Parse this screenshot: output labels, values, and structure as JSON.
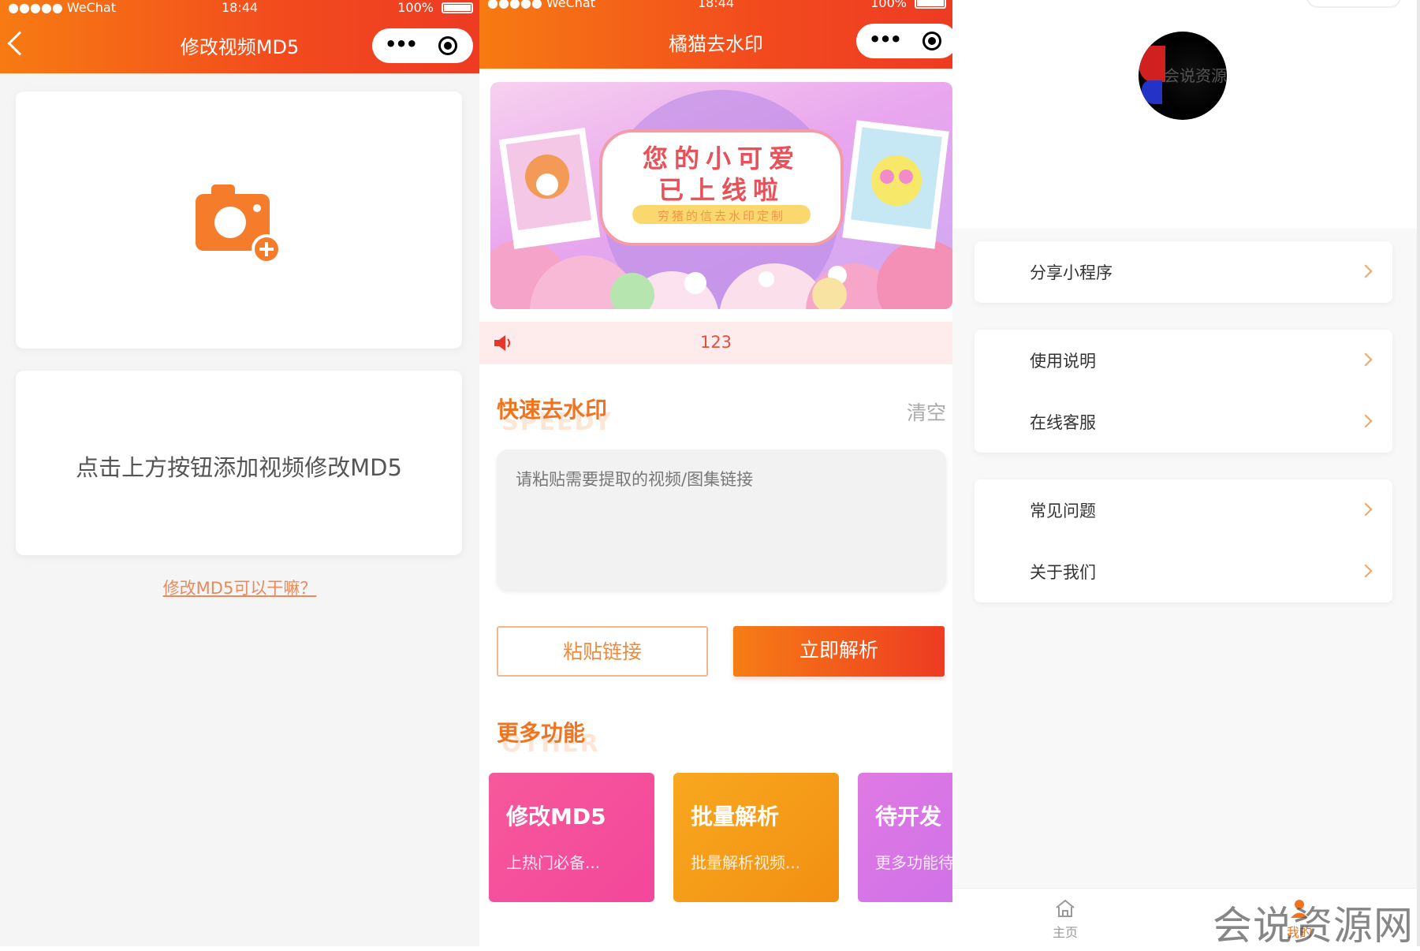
{
  "status": {
    "carrier": "●●●●● WeChat",
    "time": "18:44",
    "battery": "100%"
  },
  "panel1": {
    "title": "修改视频MD5",
    "hint": "点击上方按钮添加视频修改MD5",
    "link": "修改MD5可以干嘛？"
  },
  "panel2": {
    "title": "橘猫去水印",
    "banner": {
      "line1": "您的小可爱",
      "line2": "已上线啦",
      "tagline": "穷猪的信去水印定制"
    },
    "notice": "123",
    "section1": {
      "title": "快速去水印",
      "sub": "SPEEDY",
      "clear": "清空"
    },
    "input_placeholder": "请粘贴需要提取的视频/图集链接",
    "paste_btn": "粘贴链接",
    "parse_btn": "立即解析",
    "section2": {
      "title": "更多功能",
      "sub": "OTHER"
    },
    "features": [
      {
        "title": "修改MD5",
        "sub": "上热门必备..."
      },
      {
        "title": "批量解析",
        "sub": "批量解析视频..."
      },
      {
        "title": "待开发",
        "sub": "更多功能待..."
      }
    ]
  },
  "panel3": {
    "avatar_text": "会说资源网",
    "menus": [
      [
        "分享小程序"
      ],
      [
        "使用说明",
        "在线客服"
      ],
      [
        "常见问题",
        "关于我们"
      ]
    ],
    "tabs": {
      "home": "主页",
      "mine": "我的"
    },
    "watermark": "会说资源网"
  },
  "colors": {
    "brand_orange": "#f77b12",
    "brand_red": "#ee3b23",
    "feature_pink": "#f7589b",
    "feature_orange": "#f8a81f",
    "feature_purple": "#e07ae3"
  }
}
